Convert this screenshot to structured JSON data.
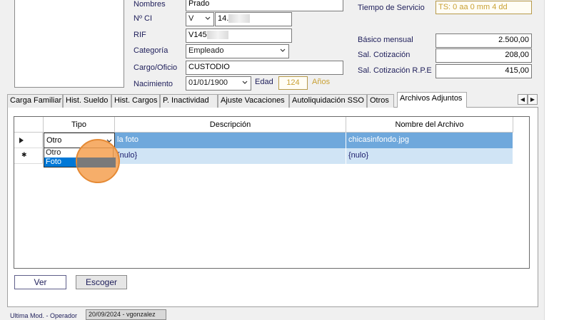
{
  "form": {
    "nombres_label": "Nombres",
    "nombres_value": "Prado",
    "ci_label": "Nº CI",
    "ci_type": "V",
    "ci_number": "14.",
    "rif_label": "RIF",
    "rif_value": "V145",
    "categoria_label": "Categoría",
    "categoria_value": "Empleado",
    "cargo_label": "Cargo/Oficio",
    "cargo_value": "CUSTODIO",
    "nacimiento_label": "Nacimiento",
    "nacimiento_value": "01/01/1900",
    "edad_label": "Edad",
    "edad_value": "124",
    "anos_label": "Años",
    "tiempo_label": "Tiempo de Servicio",
    "tiempo_value": "TS: 0 aa 0 mm 4 dd",
    "basico_label": "Básico mensual",
    "basico_value": "2.500,00",
    "cotizacion_label": "Sal. Cotización",
    "cotizacion_value": "208,00",
    "rpe_label": "Sal. Cotización R.P.E",
    "rpe_value": "415,00"
  },
  "tabs": [
    {
      "label": "Carga Familiar"
    },
    {
      "label": "Hist. Sueldo"
    },
    {
      "label": "Hist. Cargos"
    },
    {
      "label": "P.  Inactividad"
    },
    {
      "label": "Ajuste Vacaciones"
    },
    {
      "label": "Autoliquidación SSO"
    },
    {
      "label": "Otros"
    },
    {
      "label": "Archivos Adjuntos"
    }
  ],
  "grid": {
    "columns": [
      "Tipo",
      "Descripción",
      "Nombre del Archivo"
    ],
    "rows": [
      {
        "tipo": "Otro",
        "descripcion": "la foto",
        "archivo": "chicasinfondo.jpg"
      },
      {
        "tipo": "",
        "descripcion": "{nulo}",
        "archivo": "{nulo}"
      }
    ],
    "dropdown_options": [
      "Otro",
      "Foto"
    ]
  },
  "buttons": {
    "ver": "Ver",
    "escoger": "Escoger"
  },
  "footer": {
    "ultima_label": "Ultima Mod. - Operador",
    "ultima_value": "20/09/2024 - vgonzalez"
  },
  "colors": {
    "selected_row": "#6fa8dc",
    "new_row": "#d0e4f5",
    "highlight_ring": "#f5a050"
  }
}
